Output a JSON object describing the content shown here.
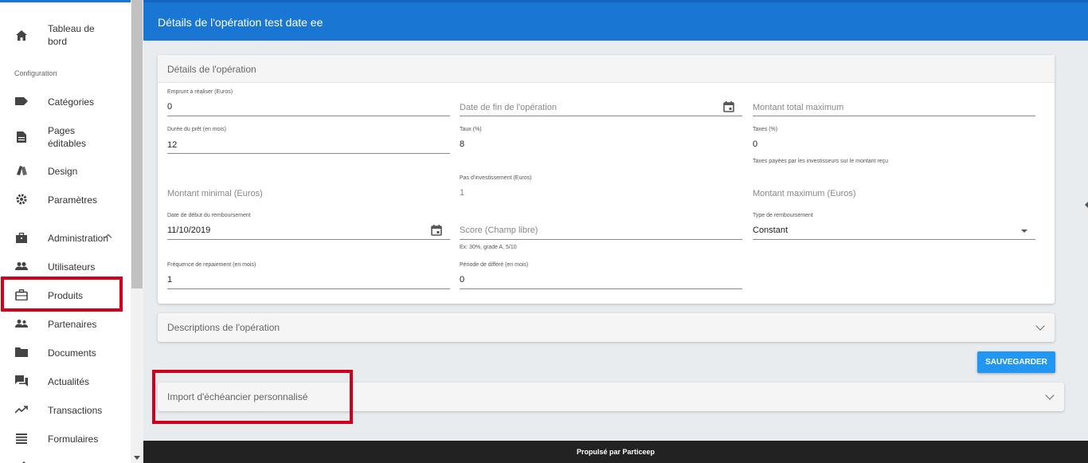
{
  "sidebar": {
    "section_configuration": "Configuration",
    "items": [
      {
        "label": "Tableau de bord",
        "icon": "home-icon"
      },
      {
        "label": "Catégories",
        "icon": "label-icon"
      },
      {
        "label": "Pages éditables",
        "icon": "document-icon"
      },
      {
        "label": "Design",
        "icon": "palette-icon"
      },
      {
        "label": "Paramètres",
        "icon": "gear-icon"
      },
      {
        "label": "Administration",
        "icon": "briefcase-icon"
      },
      {
        "label": "Utilisateurs",
        "icon": "people-icon"
      },
      {
        "label": "Produits",
        "icon": "suitcase-icon"
      },
      {
        "label": "Partenaires",
        "icon": "partners-icon"
      },
      {
        "label": "Documents",
        "icon": "folder-icon"
      },
      {
        "label": "Actualités",
        "icon": "forum-icon"
      },
      {
        "label": "Transactions",
        "icon": "trending-up-icon"
      },
      {
        "label": "Formulaires",
        "icon": "list-icon"
      }
    ]
  },
  "header": {
    "title": "Détails de l'opération test date ee"
  },
  "details": {
    "title": "Détails de l'opération",
    "fields": {
      "emprunt_label": "Emprunt à réaliser (Euros)",
      "emprunt_value": "0",
      "date_fin_placeholder": "Date de fin de l'opération",
      "montant_total_placeholder": "Montant total maximum",
      "duree_label": "Durée du prêt (en mois)",
      "duree_value": "12",
      "taux_label": "Taux (%)",
      "taux_value": "8",
      "taxes_label": "Taxes (%)",
      "taxes_value": "0",
      "taxes_help": "Taxes payées par les investisseurs sur le montant reçu",
      "montant_min_placeholder": "Montant minimal (Euros)",
      "pas_label": "Pas d'investissement (Euros)",
      "pas_value": "1",
      "montant_max_placeholder": "Montant maximum (Euros)",
      "date_debut_label": "Date de début du remboursement",
      "date_debut_value": "11/10/2019",
      "score_placeholder": "Score (Champ libre)",
      "score_help": "Ex: 30%, grade A, 5/10",
      "type_label": "Type de remboursement",
      "type_value": "Constant",
      "frequence_label": "Fréquence de repaiement (en mois)",
      "frequence_value": "1",
      "periode_label": "Période de différé (en mois)",
      "periode_value": "0"
    }
  },
  "descriptions": {
    "title": "Descriptions de l'opération"
  },
  "save_label": "SAUVEGARDER",
  "import": {
    "title": "Import d'échéancier personnalisé"
  },
  "footer": {
    "text": "Propulsé par Particeep"
  },
  "colors": {
    "accent": "#1976d2",
    "highlight": "#d0021b",
    "button": "#2196f3"
  }
}
